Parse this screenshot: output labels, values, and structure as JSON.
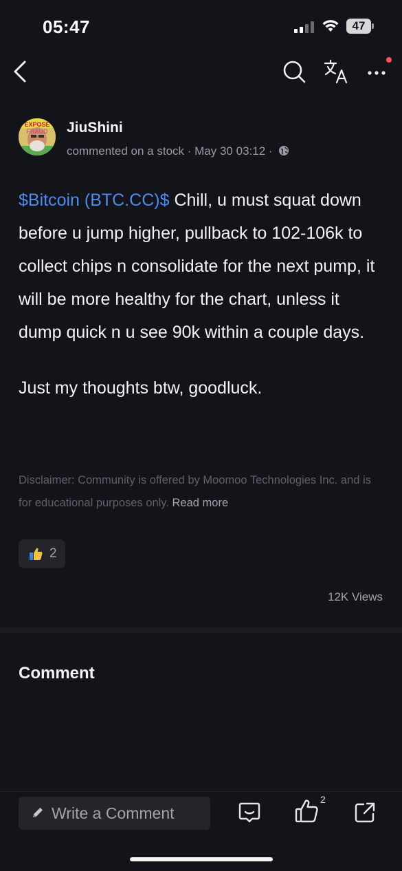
{
  "status_bar": {
    "time": "05:47",
    "battery": "47"
  },
  "author": {
    "name": "JiuShini",
    "meta": "commented on a stock · May 30 03:12 ·",
    "avatar_text": "FRAUD"
  },
  "post": {
    "ticker": "$Bitcoin (BTC.CC)$",
    "text": "Chill, u must squat down before u jump higher, pullback to 102-106k to collect chips n consolidate for the next pump, it will be more healthy for the chart, unless it dump quick n u see 90k within a couple days.",
    "text2": "Just my thoughts btw, goodluck."
  },
  "disclaimer": {
    "text": "Disclaimer: Community is offered by Moomoo Technologies Inc. and is for educational purposes only.",
    "read_more": "Read more"
  },
  "reaction": {
    "icon": "thumbs-up-emoji",
    "count": "2"
  },
  "views": "12K Views",
  "comment_heading": "Comment",
  "bottom_bar": {
    "placeholder": "Write a Comment",
    "like_count": "2"
  },
  "colors": {
    "background": "#131419",
    "ticker": "#4d8bf0",
    "muted": "#9a9ba3",
    "notification_dot": "#ff4d5b"
  }
}
